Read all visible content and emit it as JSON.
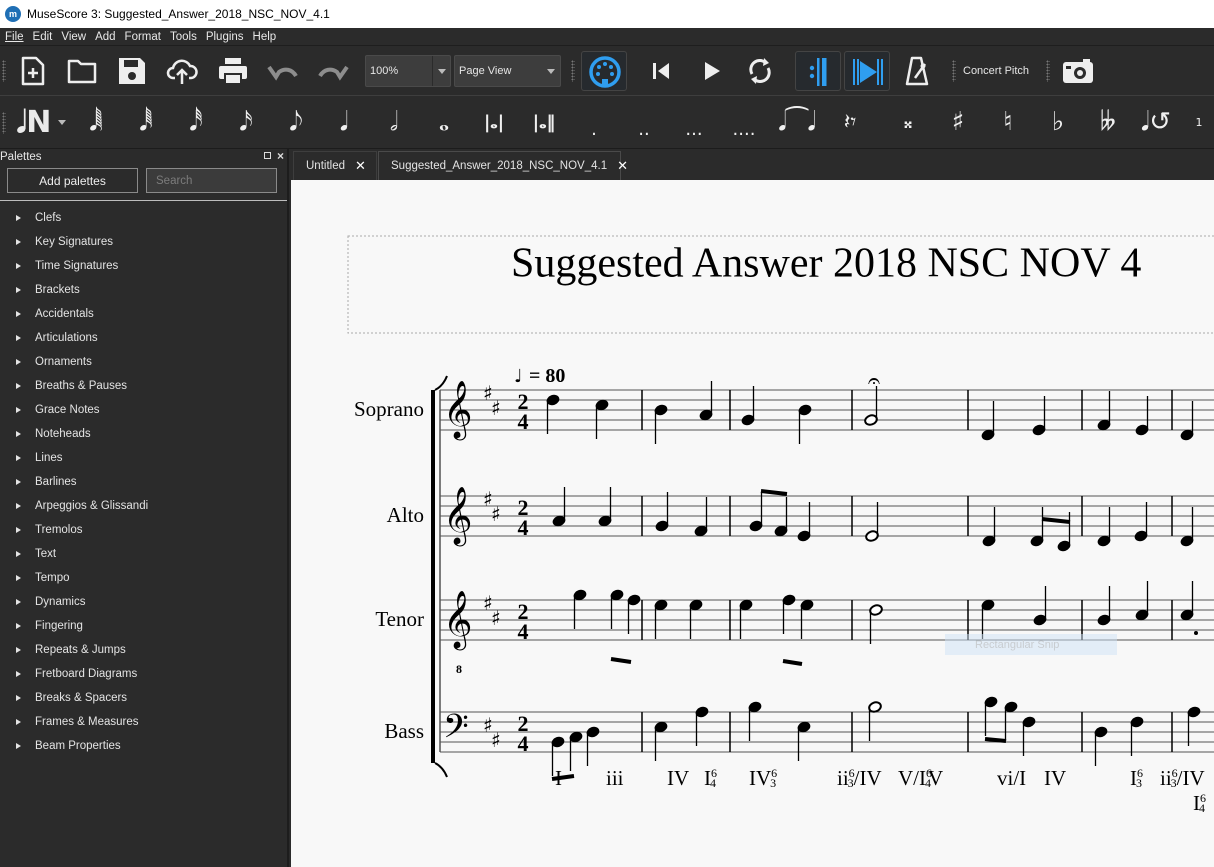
{
  "window": {
    "title": "MuseScore 3: Suggested_Answer_2018_NSC_NOV_4.1",
    "logo_icon": "musescore-logo-icon"
  },
  "menu": [
    "File",
    "Edit",
    "View",
    "Add",
    "Format",
    "Tools",
    "Plugins",
    "Help"
  ],
  "toolbar": {
    "buttons": [
      "new-score",
      "open",
      "save",
      "upload-cloud",
      "print",
      "undo",
      "redo"
    ],
    "zoom_value": "100%",
    "view_mode": "Page View",
    "playback": [
      "midi-input",
      "rewind",
      "play",
      "loop",
      "play-repeats",
      "pan-score",
      "metronome"
    ],
    "concert_pitch_label": "Concert Pitch",
    "image_capture": "camera"
  },
  "note_input": {
    "mode_icon": "note-input-N-icon",
    "durations": [
      "1/128",
      "1/64",
      "1/32",
      "1/16",
      "1/8",
      "1/4",
      "1/2",
      "whole",
      "breve",
      "longa"
    ],
    "dots": [
      ".",
      "..",
      "...",
      "...."
    ],
    "other": [
      "tie",
      "rest",
      "double-sharp",
      "sharp",
      "natural",
      "flat",
      "double-flat",
      "flip-direction"
    ],
    "voice_label": "1"
  },
  "palettes": {
    "title": "Palettes",
    "add_button": "Add palettes",
    "search_placeholder": "Search",
    "items": [
      "Clefs",
      "Key Signatures",
      "Time Signatures",
      "Brackets",
      "Accidentals",
      "Articulations",
      "Ornaments",
      "Breaths & Pauses",
      "Grace Notes",
      "Noteheads",
      "Lines",
      "Barlines",
      "Arpeggios & Glissandi",
      "Tremolos",
      "Text",
      "Tempo",
      "Dynamics",
      "Fingering",
      "Repeats & Jumps",
      "Fretboard Diagrams",
      "Breaks & Spacers",
      "Frames & Measures",
      "Beam Properties"
    ]
  },
  "tabs": [
    {
      "label": "Untitled",
      "active": false
    },
    {
      "label": "Suggested_Answer_2018_NSC_NOV_4.1",
      "active": true
    }
  ],
  "score": {
    "title": "Suggested Answer 2018 NSC NOV 4",
    "tempo": "= 80",
    "time_signature": {
      "top": "2",
      "bottom": "4"
    },
    "key": "D major (2 sharps)",
    "staves": [
      "Soprano",
      "Alto",
      "Tenor",
      "Bass"
    ],
    "tenor_clef_octave": "8",
    "roman_numerals": [
      {
        "text": "I",
        "sup": "",
        "sub": ""
      },
      {
        "text": "iii",
        "sup": "",
        "sub": ""
      },
      {
        "text": "IV",
        "sup": "",
        "sub": ""
      },
      {
        "text": "I",
        "sup": "6",
        "sub": "4"
      },
      {
        "text": "IV",
        "sup": "6",
        "sub": "3"
      },
      {
        "text": "ii",
        "sup": "6",
        "sub": "3",
        "suffix": "/IV"
      },
      {
        "text": "V/I",
        "sup": "6",
        "sub": "4"
      },
      {
        "text": "V",
        "sup": "",
        "sub": ""
      },
      {
        "text": "vi/I",
        "sup": "",
        "sub": ""
      },
      {
        "text": "IV",
        "sup": "",
        "sub": ""
      },
      {
        "text": "I",
        "sup": "6",
        "sub": "3"
      },
      {
        "text": "ii",
        "sup": "6",
        "sub": "3",
        "suffix": "/IV"
      },
      {
        "text": "I",
        "sup": "6",
        "sub": "4"
      }
    ]
  },
  "overlay": {
    "snip_label": "Rectangular Snip"
  }
}
